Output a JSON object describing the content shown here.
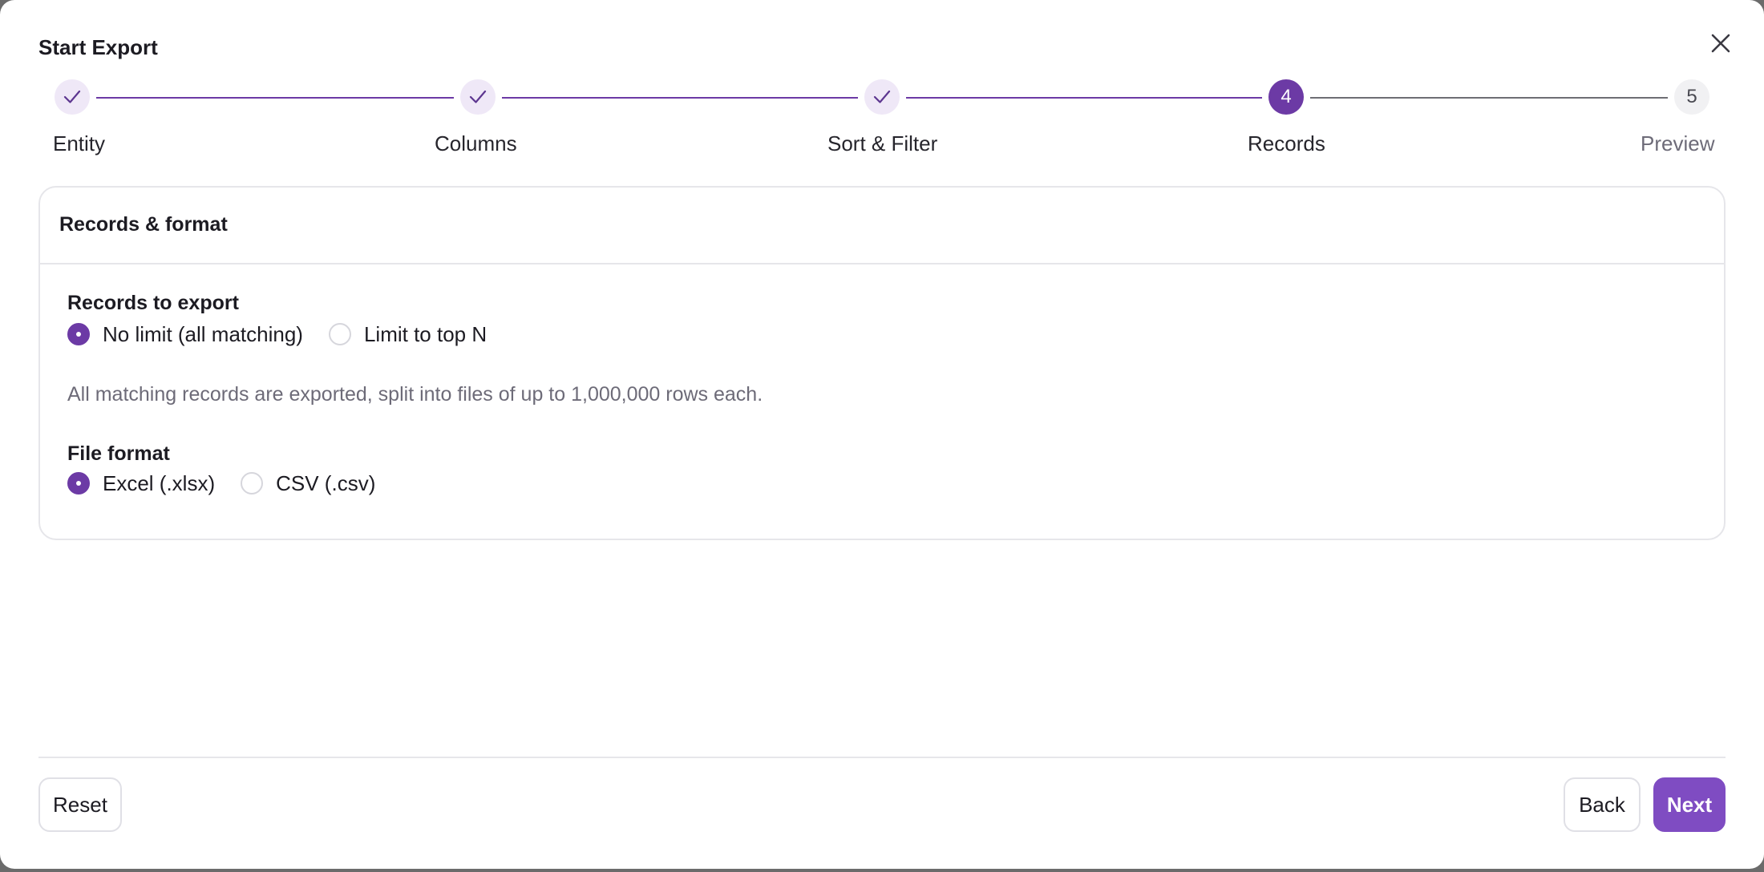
{
  "dialog": {
    "title": "Start Export",
    "close_icon": "close-icon"
  },
  "stepper": {
    "steps": [
      {
        "label": "Entity",
        "status": "done",
        "marker": "check-icon"
      },
      {
        "label": "Columns",
        "status": "done",
        "marker": "check-icon"
      },
      {
        "label": "Sort & Filter",
        "status": "done",
        "marker": "check-icon"
      },
      {
        "label": "Records",
        "status": "current",
        "marker": "4"
      },
      {
        "label": "Preview",
        "status": "pending",
        "marker": "5"
      }
    ]
  },
  "card": {
    "title": "Records & format",
    "records_section": {
      "label": "Records to export",
      "options": [
        {
          "label": "No limit (all matching)",
          "checked": true
        },
        {
          "label": "Limit to top N",
          "checked": false
        }
      ],
      "help_text": "All matching records are exported, split into files of up to 1,000,000 rows each."
    },
    "format_section": {
      "label": "File format",
      "options": [
        {
          "label": "Excel (.xlsx)",
          "checked": true
        },
        {
          "label": "CSV (.csv)",
          "checked": false
        }
      ]
    }
  },
  "footer": {
    "reset_label": "Reset",
    "back_label": "Back",
    "next_label": "Next"
  },
  "colors": {
    "accent": "#6c3aa5",
    "primary_button": "#7f4cc2",
    "done_step_bg": "#efe8f7"
  }
}
